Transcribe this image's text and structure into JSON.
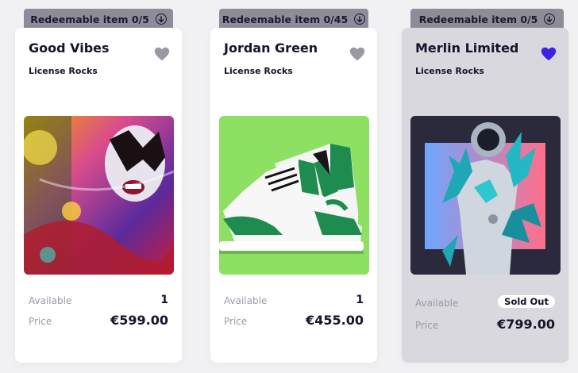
{
  "cards": [
    {
      "tab": "Redeemable item 0/5",
      "title": "Good Vibes",
      "subtitle": "License Rocks",
      "heart_color": "#9a99a3",
      "favorited": false,
      "image": "rock-musician-face-paint",
      "available_label": "Available",
      "available_value": "1",
      "price_label": "Price",
      "price": "€599.00"
    },
    {
      "tab": "Redeemable item 0/45",
      "title": "Jordan Green",
      "subtitle": "License Rocks",
      "heart_color": "#9a99a3",
      "favorited": false,
      "image": "green-white-high-top-sneaker",
      "available_label": "Available",
      "available_value": "1",
      "price_label": "Price",
      "price": "€455.00"
    },
    {
      "tab": "Redeemable item 0/5",
      "title": "Merlin Limited",
      "subtitle": "License Rocks",
      "heart_color": "#3d21e8",
      "favorited": true,
      "image": "crystal-astronaut",
      "available_label": "Available",
      "status_badge": "Sold Out",
      "price_label": "Price",
      "price": "€799.00"
    }
  ],
  "icons": {
    "tab": "download-circle-icon",
    "heart": "heart-icon"
  }
}
